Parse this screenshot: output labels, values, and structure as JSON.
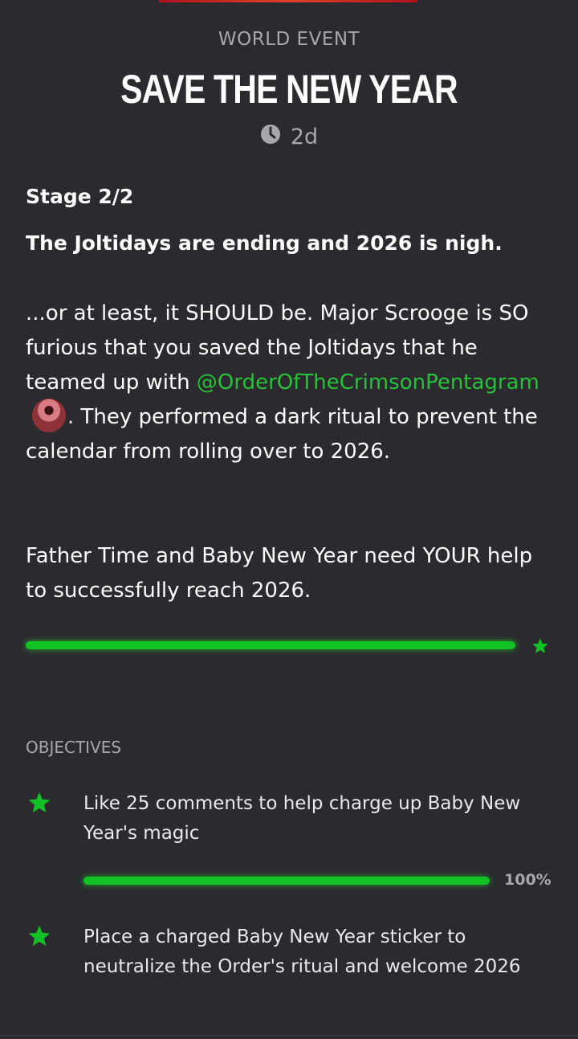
{
  "header": {
    "eyebrow": "WORLD EVENT",
    "title": "SAVE THE NEW YEAR",
    "time_remaining": "2d",
    "clock_icon": "clock-icon"
  },
  "stage": {
    "label": "Stage 2/2"
  },
  "description": {
    "lead": "The Joltidays are ending and 2026 is nigh.",
    "para1_before": "...or at least, it SHOULD be. Major Scrooge is SO furious that you saved the Joltidays that he teamed up with ",
    "mention": "@OrderOfTheCrimsonPentagram",
    "para1_after": ". They performed a dark ritual to prevent the calendar from rolling over to 2026.",
    "para2": "Father Time and Baby New Year need YOUR help to successfully reach 2026."
  },
  "event_progress": {
    "fraction": 1.0,
    "end_icon": "star-icon"
  },
  "objectives": {
    "heading": "OBJECTIVES",
    "items": [
      {
        "text": "Like 25 comments to help charge up Baby New Year's magic",
        "progress_fraction": 1.0,
        "percent_label": "100%",
        "icon": "star-icon"
      },
      {
        "text": "Place a charged Baby New Year sticker to neutralize the Order's ritual and welcome 2026",
        "icon": "star-icon"
      }
    ]
  },
  "colors": {
    "background": "#2c2a2e",
    "accent_green": "#12c225",
    "mention_green": "#25c23a",
    "muted_text": "#a9a7ab"
  }
}
